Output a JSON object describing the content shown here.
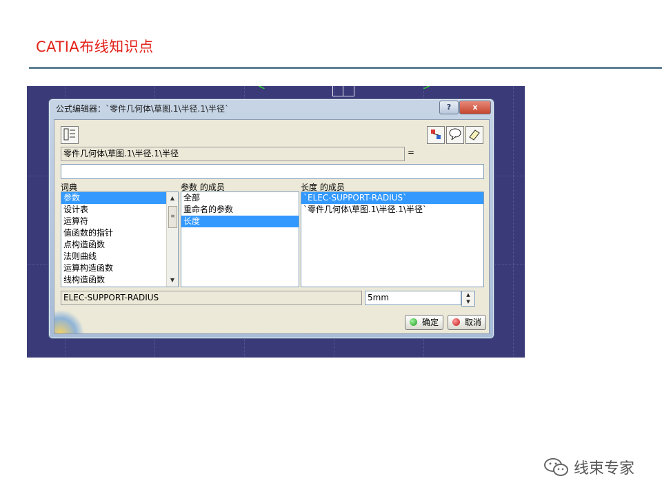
{
  "slide": {
    "title": "CATIA布线知识点"
  },
  "dialog": {
    "title": "公式编辑器：`零件几何体\\草图.1\\半径.1\\半径`",
    "help_label": "?",
    "close_label": "x",
    "path_field": "零件几何体\\草图.1\\半径.1\\半径",
    "equals": "=",
    "formula_input": "",
    "columns": [
      {
        "label": "词典",
        "items": [
          "参数",
          "设计表",
          "运算符",
          "值函数的指针",
          "点构造函数",
          "法则曲线",
          "运算构造函数",
          "线构造函数"
        ],
        "selected": 0
      },
      {
        "label": "参数 的成员",
        "items": [
          "全部",
          "重命名的参数",
          "长度"
        ],
        "selected": 2
      },
      {
        "label": "长度 的成员",
        "items": [
          "`ELEC-SUPPORT-RADIUS`",
          "`零件几何体\\草图.1\\半径.1\\半径`"
        ],
        "selected": 0
      }
    ],
    "name_field": "ELEC-SUPPORT-RADIUS",
    "value_field": "5mm",
    "ok_label": "确定",
    "cancel_label": "取消"
  },
  "icons": [
    "formula-editor-icon",
    "measure-icon",
    "comment-icon",
    "eraser-icon",
    "wechat-icon"
  ],
  "watermark": {
    "text": "线束专家"
  },
  "colors": {
    "title_red": "#e2231a",
    "canvas_bg": "#3b3a78",
    "selection": "#3399ff"
  }
}
